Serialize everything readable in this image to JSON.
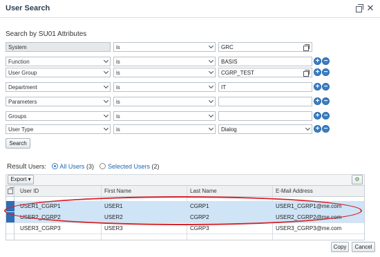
{
  "window": {
    "title": "User Search"
  },
  "search": {
    "section_title": "Search by SU01 Attributes",
    "rows": [
      {
        "attribute": "System",
        "operator": "is",
        "value": "GRC",
        "disabled": true
      },
      {
        "attribute": "Function",
        "operator": "is",
        "value": "BASIS"
      },
      {
        "attribute": "User Group",
        "operator": "is",
        "value": "CGRP_TEST"
      },
      {
        "attribute": "Department",
        "operator": "is",
        "value": "IT"
      },
      {
        "attribute": "Parameters",
        "operator": "is",
        "value": ""
      },
      {
        "attribute": "Groups",
        "operator": "is",
        "value": ""
      },
      {
        "attribute": "User Type",
        "operator": "is",
        "value": "Dialog"
      }
    ],
    "search_button": "Search"
  },
  "result": {
    "label": "Result",
    "users_label": "Users:",
    "all_users": "All Users",
    "all_count": "(3)",
    "selected_users": "Selected Users",
    "selected_count": "(2)",
    "export_button": "Export"
  },
  "table": {
    "columns": [
      "User ID",
      "First Name",
      "Last Name",
      "E-Mail Address"
    ],
    "rows": [
      {
        "user_id": "USER1_CGRP1",
        "first_name": "USER1",
        "last_name": "CGRP1",
        "email": "USER1_CGRP1@me.com",
        "selected": true
      },
      {
        "user_id": "USER2_CGRP2",
        "first_name": "USER2",
        "last_name": "CGRP2",
        "email": "USER2_CGRP2@me.com",
        "selected": true
      },
      {
        "user_id": "USER3_CGRP3",
        "first_name": "USER3",
        "last_name": "CGRP3",
        "email": "USER3_CGRP3@me.com",
        "selected": false
      }
    ]
  },
  "footer": {
    "copy_button": "Copy",
    "cancel_button": "Cancel"
  },
  "colors": {
    "accent": "#3a7fc4",
    "selection": "#cfe4f6",
    "highlight_oval": "#d8222a"
  }
}
